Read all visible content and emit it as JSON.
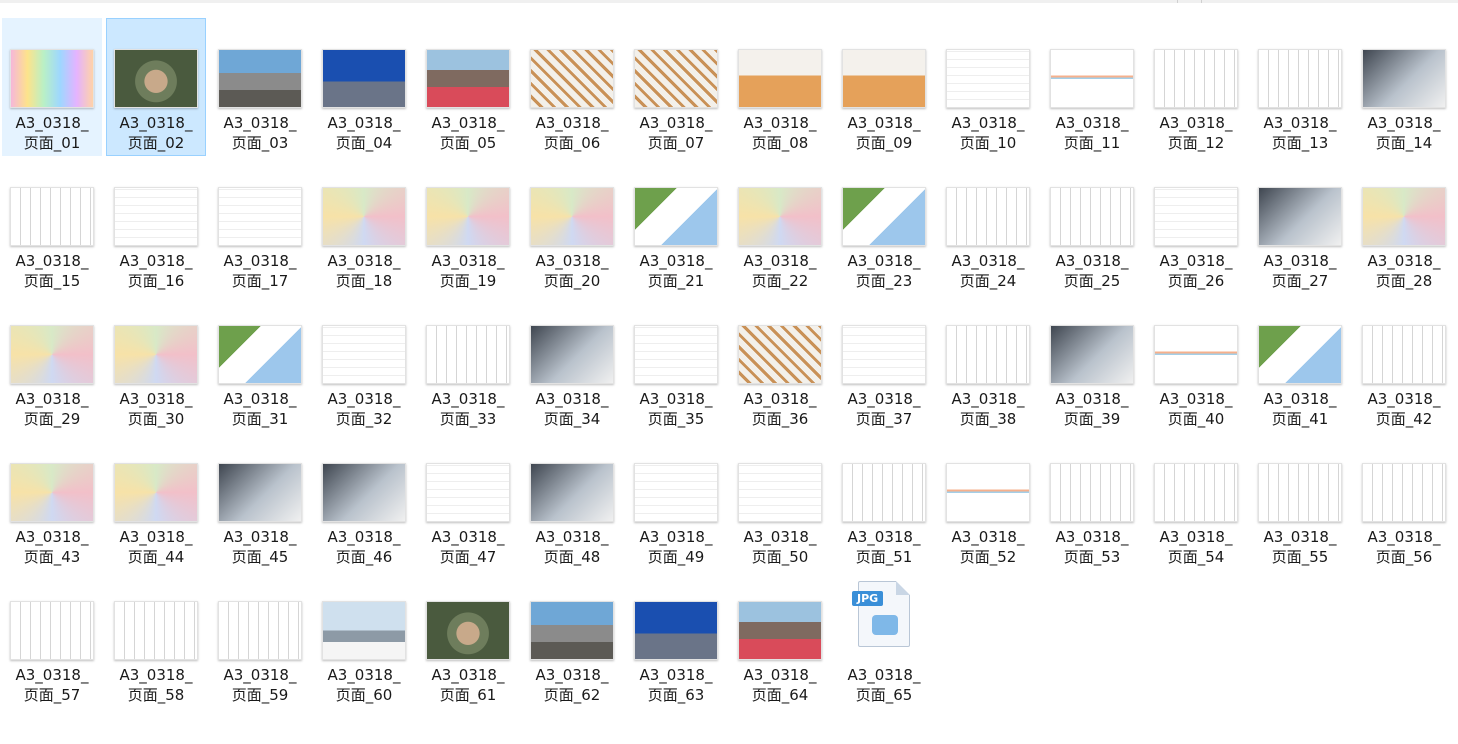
{
  "window": {
    "view": "large-icons"
  },
  "files": [
    {
      "label": "A3_0318_\n页面_01",
      "thumb": "t-rainbow",
      "state": "hover"
    },
    {
      "label": "A3_0318_\n页面_02",
      "thumb": "t-aerial",
      "state": "selected"
    },
    {
      "label": "A3_0318_\n页面_03",
      "thumb": "t-street"
    },
    {
      "label": "A3_0318_\n页面_04",
      "thumb": "t-blue"
    },
    {
      "label": "A3_0318_\n页面_05",
      "thumb": "t-red"
    },
    {
      "label": "A3_0318_\n页面_06",
      "thumb": "t-model"
    },
    {
      "label": "A3_0318_\n页面_07",
      "thumb": "t-model"
    },
    {
      "label": "A3_0318_\n页面_08",
      "thumb": "t-orange"
    },
    {
      "label": "A3_0318_\n页面_09",
      "thumb": "t-orange"
    },
    {
      "label": "A3_0318_\n页面_10",
      "thumb": "t-diagram"
    },
    {
      "label": "A3_0318_\n页面_11",
      "thumb": "t-stripe"
    },
    {
      "label": "A3_0318_\n页面_12",
      "thumb": "t-cad"
    },
    {
      "label": "A3_0318_\n页面_13",
      "thumb": "t-cad"
    },
    {
      "label": "A3_0318_\n页面_14",
      "thumb": "t-dark"
    },
    {
      "label": "A3_0318_\n页面_15",
      "thumb": "t-cad"
    },
    {
      "label": "A3_0318_\n页面_16",
      "thumb": "t-diagram"
    },
    {
      "label": "A3_0318_\n页面_17",
      "thumb": "t-diagram"
    },
    {
      "label": "A3_0318_\n页面_18",
      "thumb": "t-color"
    },
    {
      "label": "A3_0318_\n页面_19",
      "thumb": "t-color"
    },
    {
      "label": "A3_0318_\n页面_20",
      "thumb": "t-color"
    },
    {
      "label": "A3_0318_\n页面_21",
      "thumb": "t-green"
    },
    {
      "label": "A3_0318_\n页面_22",
      "thumb": "t-color"
    },
    {
      "label": "A3_0318_\n页面_23",
      "thumb": "t-green"
    },
    {
      "label": "A3_0318_\n页面_24",
      "thumb": "t-cad"
    },
    {
      "label": "A3_0318_\n页面_25",
      "thumb": "t-cad"
    },
    {
      "label": "A3_0318_\n页面_26",
      "thumb": "t-diagram"
    },
    {
      "label": "A3_0318_\n页面_27",
      "thumb": "t-dark"
    },
    {
      "label": "A3_0318_\n页面_28",
      "thumb": "t-color"
    },
    {
      "label": "A3_0318_\n页面_29",
      "thumb": "t-color"
    },
    {
      "label": "A3_0318_\n页面_30",
      "thumb": "t-color"
    },
    {
      "label": "A3_0318_\n页面_31",
      "thumb": "t-green"
    },
    {
      "label": "A3_0318_\n页面_32",
      "thumb": "t-diagram"
    },
    {
      "label": "A3_0318_\n页面_33",
      "thumb": "t-cad"
    },
    {
      "label": "A3_0318_\n页面_34",
      "thumb": "t-dark"
    },
    {
      "label": "A3_0318_\n页面_35",
      "thumb": "t-diagram"
    },
    {
      "label": "A3_0318_\n页面_36",
      "thumb": "t-model"
    },
    {
      "label": "A3_0318_\n页面_37",
      "thumb": "t-diagram"
    },
    {
      "label": "A3_0318_\n页面_38",
      "thumb": "t-cad"
    },
    {
      "label": "A3_0318_\n页面_39",
      "thumb": "t-dark"
    },
    {
      "label": "A3_0318_\n页面_40",
      "thumb": "t-stripe"
    },
    {
      "label": "A3_0318_\n页面_41",
      "thumb": "t-green"
    },
    {
      "label": "A3_0318_\n页面_42",
      "thumb": "t-cad"
    },
    {
      "label": "A3_0318_\n页面_43",
      "thumb": "t-color"
    },
    {
      "label": "A3_0318_\n页面_44",
      "thumb": "t-color"
    },
    {
      "label": "A3_0318_\n页面_45",
      "thumb": "t-dark"
    },
    {
      "label": "A3_0318_\n页面_46",
      "thumb": "t-dark"
    },
    {
      "label": "A3_0318_\n页面_47",
      "thumb": "t-diagram"
    },
    {
      "label": "A3_0318_\n页面_48",
      "thumb": "t-dark"
    },
    {
      "label": "A3_0318_\n页面_49",
      "thumb": "t-diagram"
    },
    {
      "label": "A3_0318_\n页面_50",
      "thumb": "t-diagram"
    },
    {
      "label": "A3_0318_\n页面_51",
      "thumb": "t-cad"
    },
    {
      "label": "A3_0318_\n页面_52",
      "thumb": "t-stripe"
    },
    {
      "label": "A3_0318_\n页面_53",
      "thumb": "t-cad"
    },
    {
      "label": "A3_0318_\n页面_54",
      "thumb": "t-cad"
    },
    {
      "label": "A3_0318_\n页面_55",
      "thumb": "t-cad"
    },
    {
      "label": "A3_0318_\n页面_56",
      "thumb": "t-cad"
    },
    {
      "label": "A3_0318_\n页面_57",
      "thumb": "t-cad"
    },
    {
      "label": "A3_0318_\n页面_58",
      "thumb": "t-cad"
    },
    {
      "label": "A3_0318_\n页面_59",
      "thumb": "t-cad"
    },
    {
      "label": "A3_0318_\n页面_60",
      "thumb": "t-skyline"
    },
    {
      "label": "A3_0318_\n页面_61",
      "thumb": "t-aerial"
    },
    {
      "label": "A3_0318_\n页面_62",
      "thumb": "t-street"
    },
    {
      "label": "A3_0318_\n页面_63",
      "thumb": "t-blue"
    },
    {
      "label": "A3_0318_\n页面_64",
      "thumb": "t-red"
    },
    {
      "label": "A3_0318_\n页面_65",
      "thumb": "jpg-file",
      "badge": "JPG"
    }
  ],
  "colors": {
    "selected_bg": "#cce8ff",
    "selected_border": "#99d1ff",
    "hover_bg": "#e5f3ff"
  }
}
